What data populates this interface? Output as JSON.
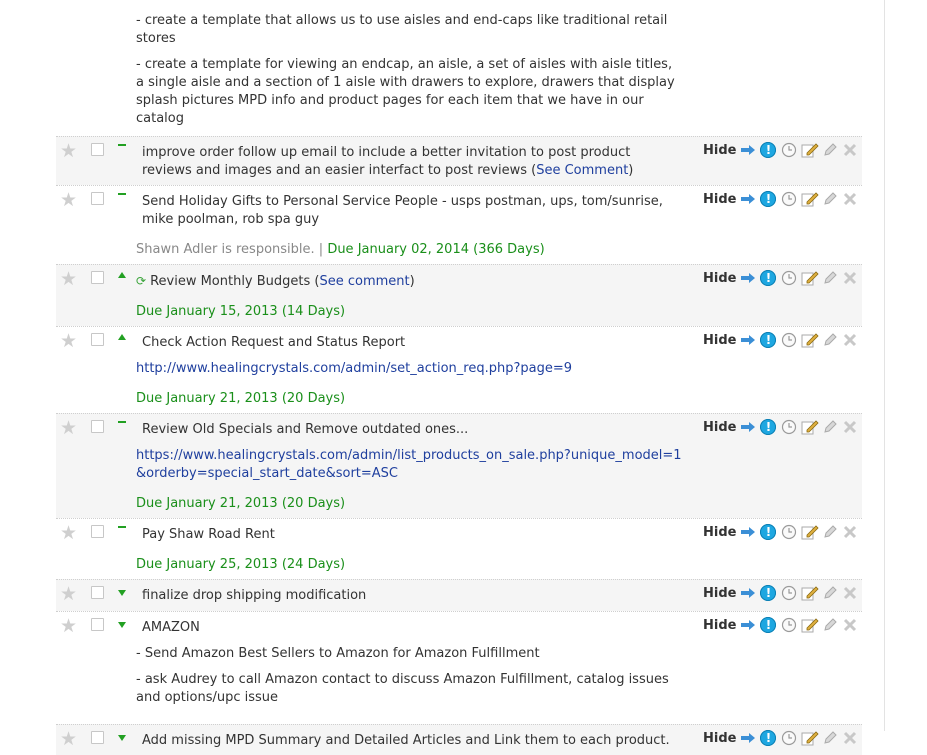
{
  "intro": {
    "lines": [
      "- create a template that allows us to use aisles and end-caps like traditional retail stores",
      "- create a template for viewing an endcap, an aisle, a set of aisles with aisle titles, a single aisle and a section of 1 aisle with drawers to explore, drawers that display splash pictures MPD info and product pages for each item that we have in our catalog"
    ]
  },
  "action_labels": {
    "hide": "Hide",
    "info": "!"
  },
  "tasks": [
    {
      "priority": "normal",
      "title": "improve order follow up email to include a better invitation to post product reviews and images and an easier interfact to post reviews (",
      "title_link": "See Comment",
      "title_suffix": ")"
    },
    {
      "priority": "normal",
      "title": "Send Holiday Gifts to Personal Service People - usps postman, ups, tom/sunrise, mike poolman, rob spa guy",
      "responsible": "Shawn Adler",
      "responsible_text": " is responsible. ",
      "separator": "|",
      "due": "Due January 02, 2014 (366 Days)"
    },
    {
      "priority": "high",
      "recurring": true,
      "title": "Review Monthly Budgets (",
      "title_link": "See comment",
      "title_suffix": ")",
      "due": "Due January 15, 2013 (14 Days)"
    },
    {
      "priority": "high",
      "title": "Check Action Request and Status Report",
      "link": "http://www.healingcrystals.com/admin/set_action_req.php?page=9",
      "due": "Due January 21, 2013 (20 Days)"
    },
    {
      "priority": "normal",
      "title": "Review Old Specials and Remove outdated ones...",
      "link": "https://www.healingcrystals.com/admin/list_products_on_sale.php?unique_model=1&orderby=special_start_date&sort=ASC",
      "due": "Due January 21, 2013 (20 Days)"
    },
    {
      "priority": "normal",
      "title": "Pay Shaw Road Rent",
      "due": "Due January 25, 2013 (24 Days)"
    },
    {
      "priority": "low",
      "title": "finalize drop shipping modification"
    },
    {
      "priority": "low",
      "title": "AMAZON",
      "notes": [
        "- Send Amazon Best Sellers to Amazon for Amazon Fulfillment",
        "- ask Audrey to call Amazon contact to discuss Amazon Fulfillment, catalog issues and options/upc issue"
      ]
    },
    {
      "priority": "low",
      "title": "Add missing MPD Summary and Detailed Articles and Link them to each product."
    }
  ],
  "colors": {
    "due": "#1a8f1a",
    "link": "#1f3f9e",
    "priority": "#22a022",
    "info": "#1ea7e1"
  }
}
